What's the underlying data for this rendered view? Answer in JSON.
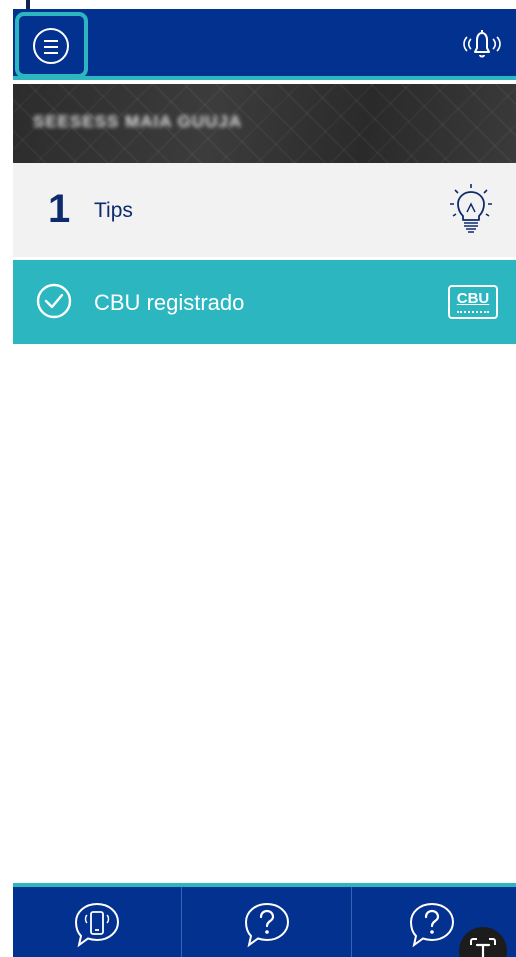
{
  "header": {
    "menu_icon": "menu-icon",
    "notification_icon": "bell-icon"
  },
  "banner": {
    "user_name": "SEESESS MAIA GUUJA"
  },
  "tips": {
    "count": "1",
    "label": "Tips",
    "icon": "lightbulb-icon"
  },
  "cbu": {
    "label": "CBU registrado",
    "badge_text": "CBU",
    "icon": "check-circle-icon"
  },
  "bottom_nav": {
    "items": [
      {
        "icon": "phone-chat-icon"
      },
      {
        "icon": "help-icon"
      },
      {
        "icon": "help-icon"
      }
    ]
  },
  "floating": {
    "icon": "text-recognition-icon"
  },
  "colors": {
    "brand_navy": "#03318f",
    "accent_teal": "#2bb6c0",
    "text_navy": "#0d2a6e",
    "row_gray": "#f2f2f2"
  }
}
